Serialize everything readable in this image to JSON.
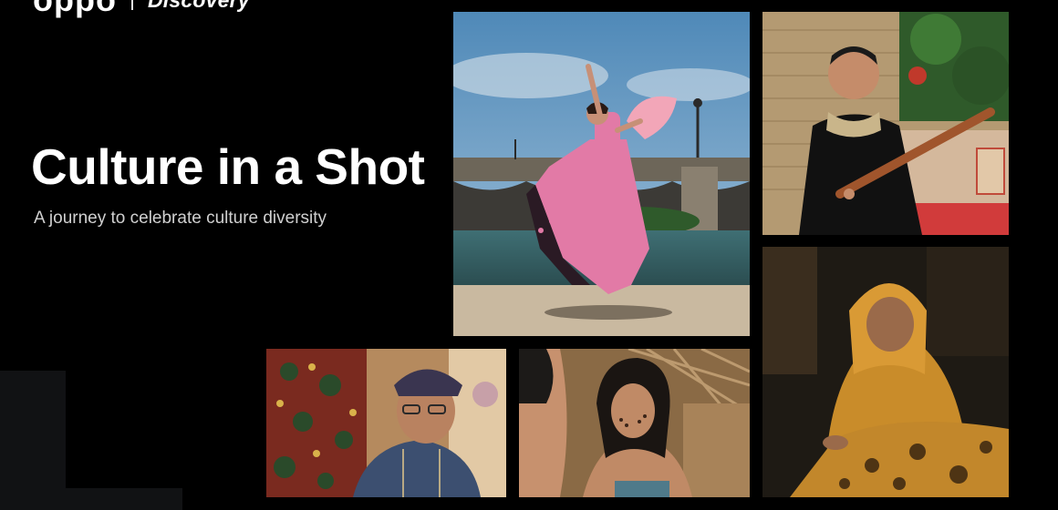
{
  "brand": {
    "primary": "oppo",
    "partner": "Discovery"
  },
  "hero": {
    "title": "Culture in a Shot",
    "subtitle": "A journey to celebrate culture diversity"
  },
  "colors": {
    "background": "#000000",
    "text": "#ffffff",
    "subtitle": "#d0d0d0",
    "panel": "#111214"
  },
  "photos": [
    {
      "subject": "flamenco dancer in pink polka-dot dress with fan by a bridge"
    },
    {
      "subject": "man playing a long-neck lute seated on a red couch"
    },
    {
      "subject": "woman in headscarf painting batik by lamplight"
    },
    {
      "subject": "elderly man in embroidered cap beside batik cloth"
    },
    {
      "subject": "child with face paint under a thatched roof"
    }
  ]
}
